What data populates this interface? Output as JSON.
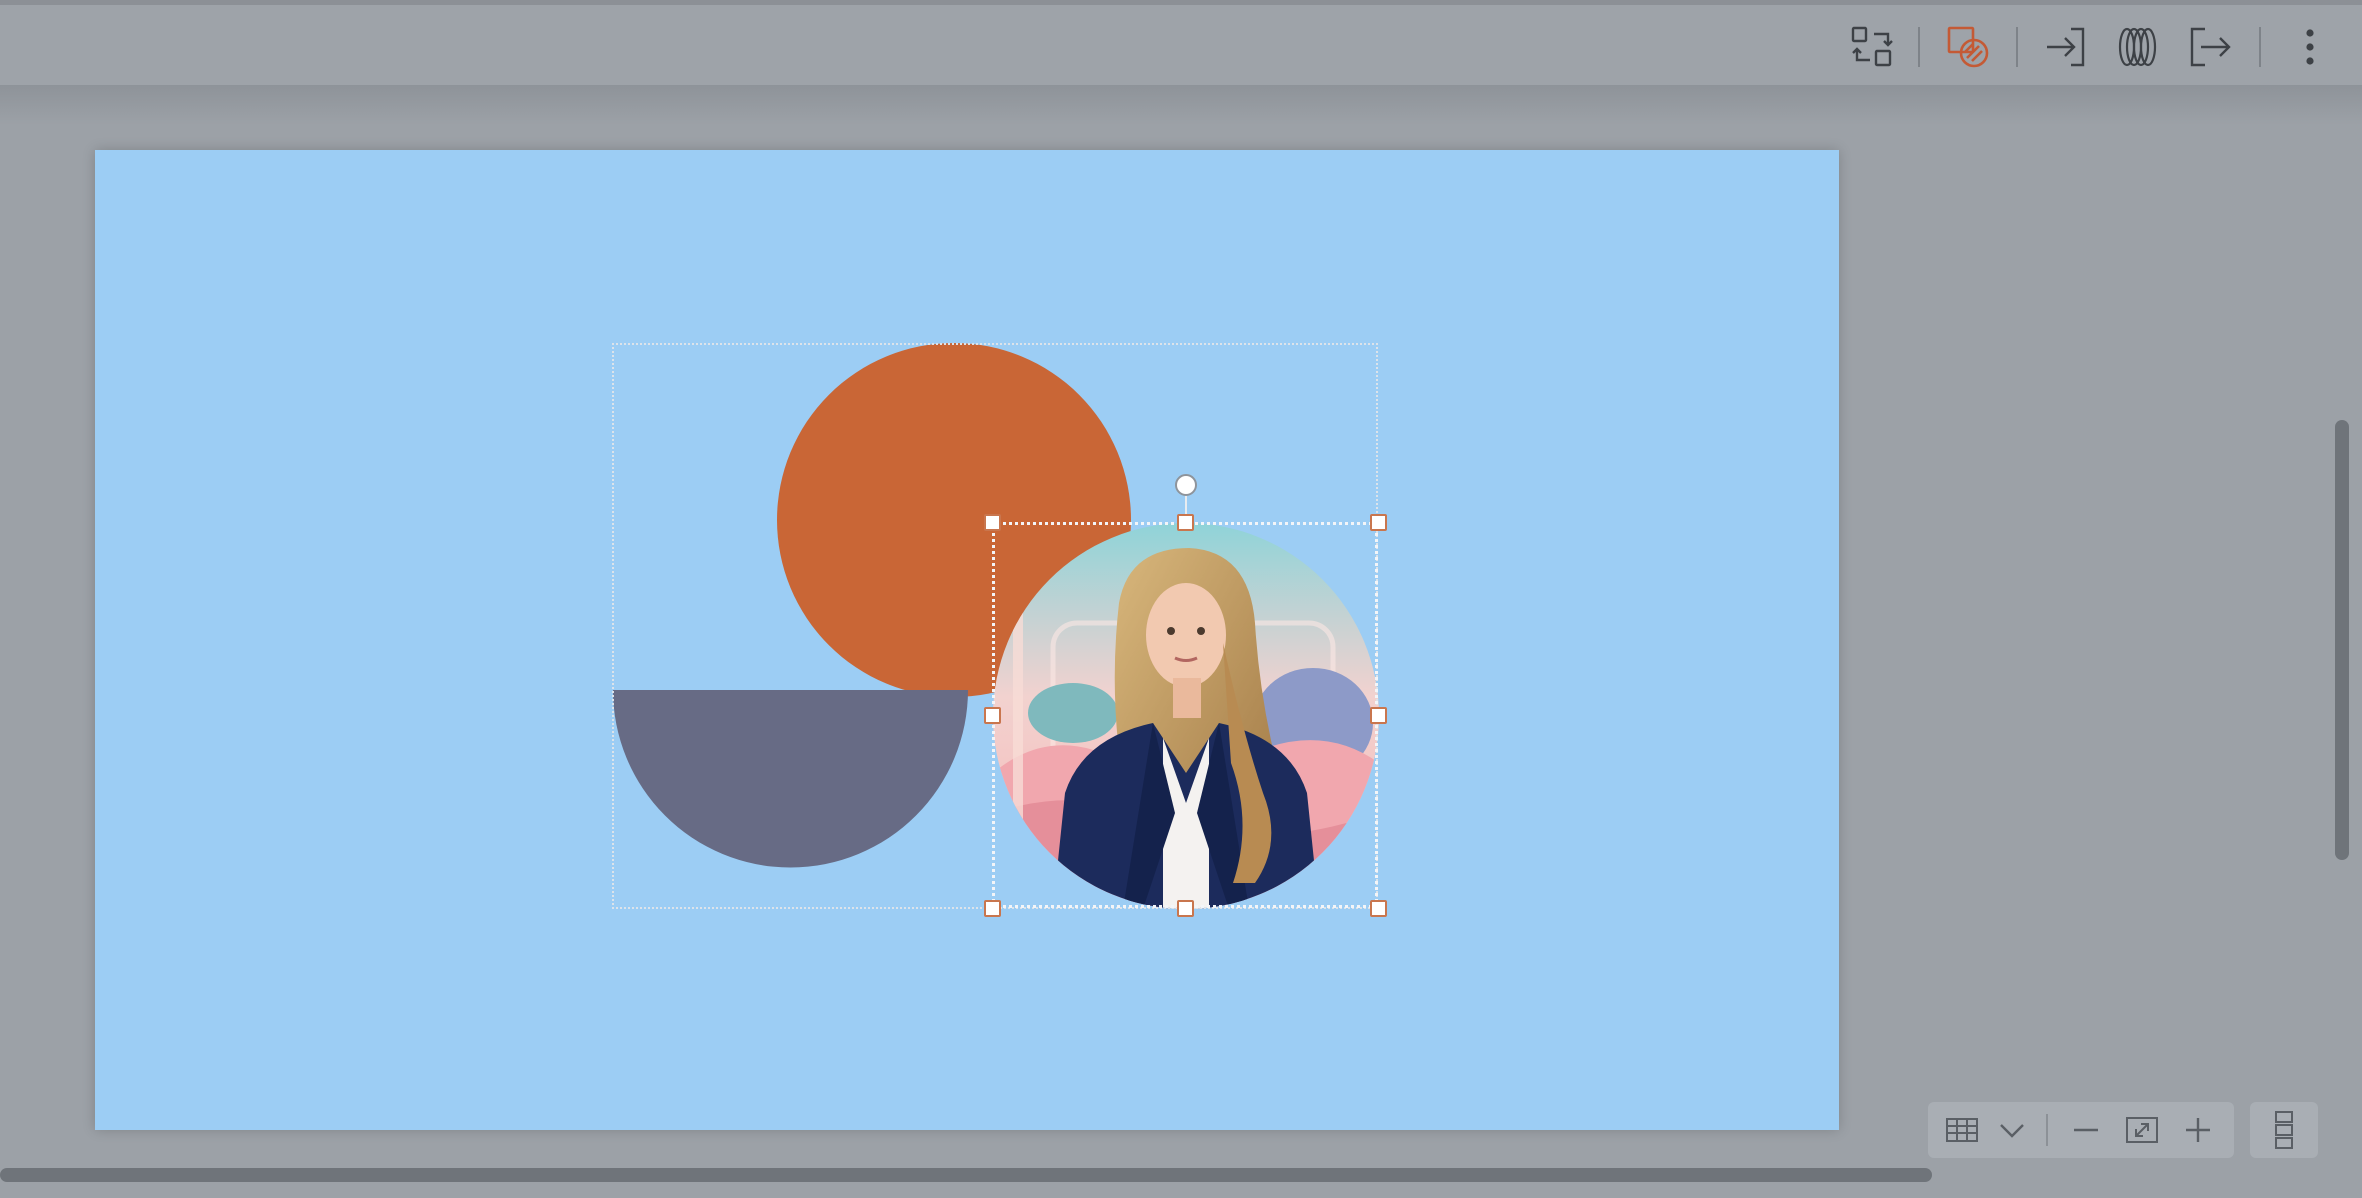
{
  "toolbar": {
    "buttons": [
      {
        "id": "swap",
        "icon": "replace-shape-icon"
      },
      {
        "id": "shape",
        "icon": "shape-format-icon",
        "active": true
      },
      {
        "id": "enter",
        "icon": "enter-group-icon"
      },
      {
        "id": "rings",
        "icon": "rings-effects-icon"
      },
      {
        "id": "exit",
        "icon": "exit-group-icon"
      },
      {
        "id": "more",
        "icon": "more-vertical-icon"
      }
    ],
    "accent_color": "#c45a35"
  },
  "slide": {
    "background_color": "#9ccdf4",
    "shapes": [
      {
        "name": "orange-circle",
        "color": "#c96636"
      },
      {
        "name": "slate-half-circle",
        "color": "#676b85"
      },
      {
        "name": "presenter-photo-circle",
        "color": "#1c2b5c"
      }
    ]
  },
  "zoom_controls": {
    "view_icon": "grid-view-icon",
    "dropdown_icon": "chevron-down-icon",
    "zoom_out_icon": "minus-icon",
    "fit_icon": "fit-to-screen-icon",
    "zoom_in_icon": "plus-icon"
  },
  "panel_toggle": {
    "icon": "panels-icon"
  }
}
